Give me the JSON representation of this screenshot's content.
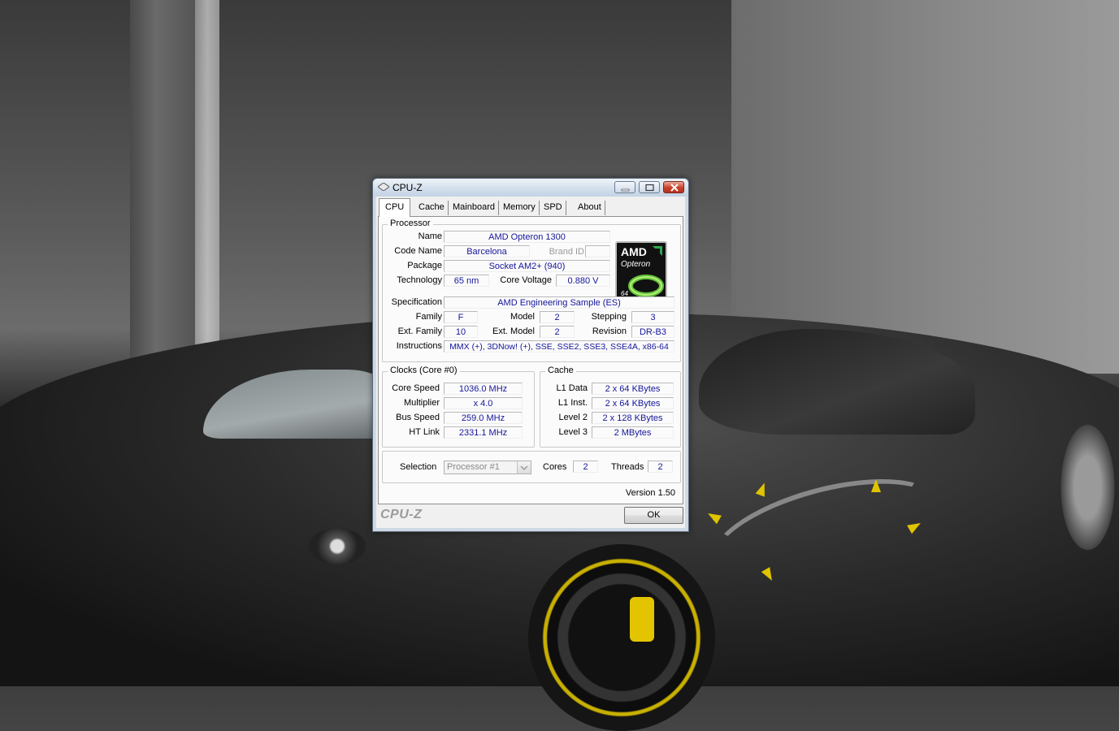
{
  "window": {
    "title": "CPU-Z"
  },
  "tabs": [
    "CPU",
    "Cache",
    "Mainboard",
    "Memory",
    "SPD",
    "About"
  ],
  "processor": {
    "group_title": "Processor",
    "name_label": "Name",
    "name": "AMD Opteron 1300",
    "code_name_label": "Code Name",
    "code_name": "Barcelona",
    "brand_id_label": "Brand ID",
    "brand_id": "",
    "package_label": "Package",
    "package": "Socket AM2+ (940)",
    "technology_label": "Technology",
    "technology": "65 nm",
    "core_voltage_label": "Core Voltage",
    "core_voltage": "0.880 V",
    "specification_label": "Specification",
    "specification": "AMD Engineering Sample (ES)",
    "family_label": "Family",
    "family": "F",
    "model_label": "Model",
    "model": "2",
    "stepping_label": "Stepping",
    "stepping": "3",
    "ext_family_label": "Ext. Family",
    "ext_family": "10",
    "ext_model_label": "Ext. Model",
    "ext_model": "2",
    "revision_label": "Revision",
    "revision": "DR-B3",
    "instructions_label": "Instructions",
    "instructions": "MMX (+), 3DNow! (+), SSE, SSE2, SSE3, SSE4A, x86-64",
    "logo": {
      "brand": "AMD",
      "product": "Opteron",
      "bits": "64"
    }
  },
  "clocks": {
    "group_title": "Clocks (Core #0)",
    "core_speed_label": "Core Speed",
    "core_speed": "1036.0 MHz",
    "multiplier_label": "Multiplier",
    "multiplier": "x 4.0",
    "bus_speed_label": "Bus Speed",
    "bus_speed": "259.0 MHz",
    "ht_link_label": "HT Link",
    "ht_link": "2331.1 MHz"
  },
  "cache": {
    "group_title": "Cache",
    "l1_data_label": "L1 Data",
    "l1_data": "2 x 64 KBytes",
    "l1_inst_label": "L1 Inst.",
    "l1_inst": "2 x 64 KBytes",
    "level2_label": "Level 2",
    "level2": "2 x 128 KBytes",
    "level3_label": "Level 3",
    "level3": "2 MBytes"
  },
  "selection": {
    "label": "Selection",
    "value": "Processor #1",
    "cores_label": "Cores",
    "cores": "2",
    "threads_label": "Threads",
    "threads": "2"
  },
  "footer": {
    "version": "Version 1.50",
    "brand": "CPU-Z",
    "ok_label": "OK"
  }
}
